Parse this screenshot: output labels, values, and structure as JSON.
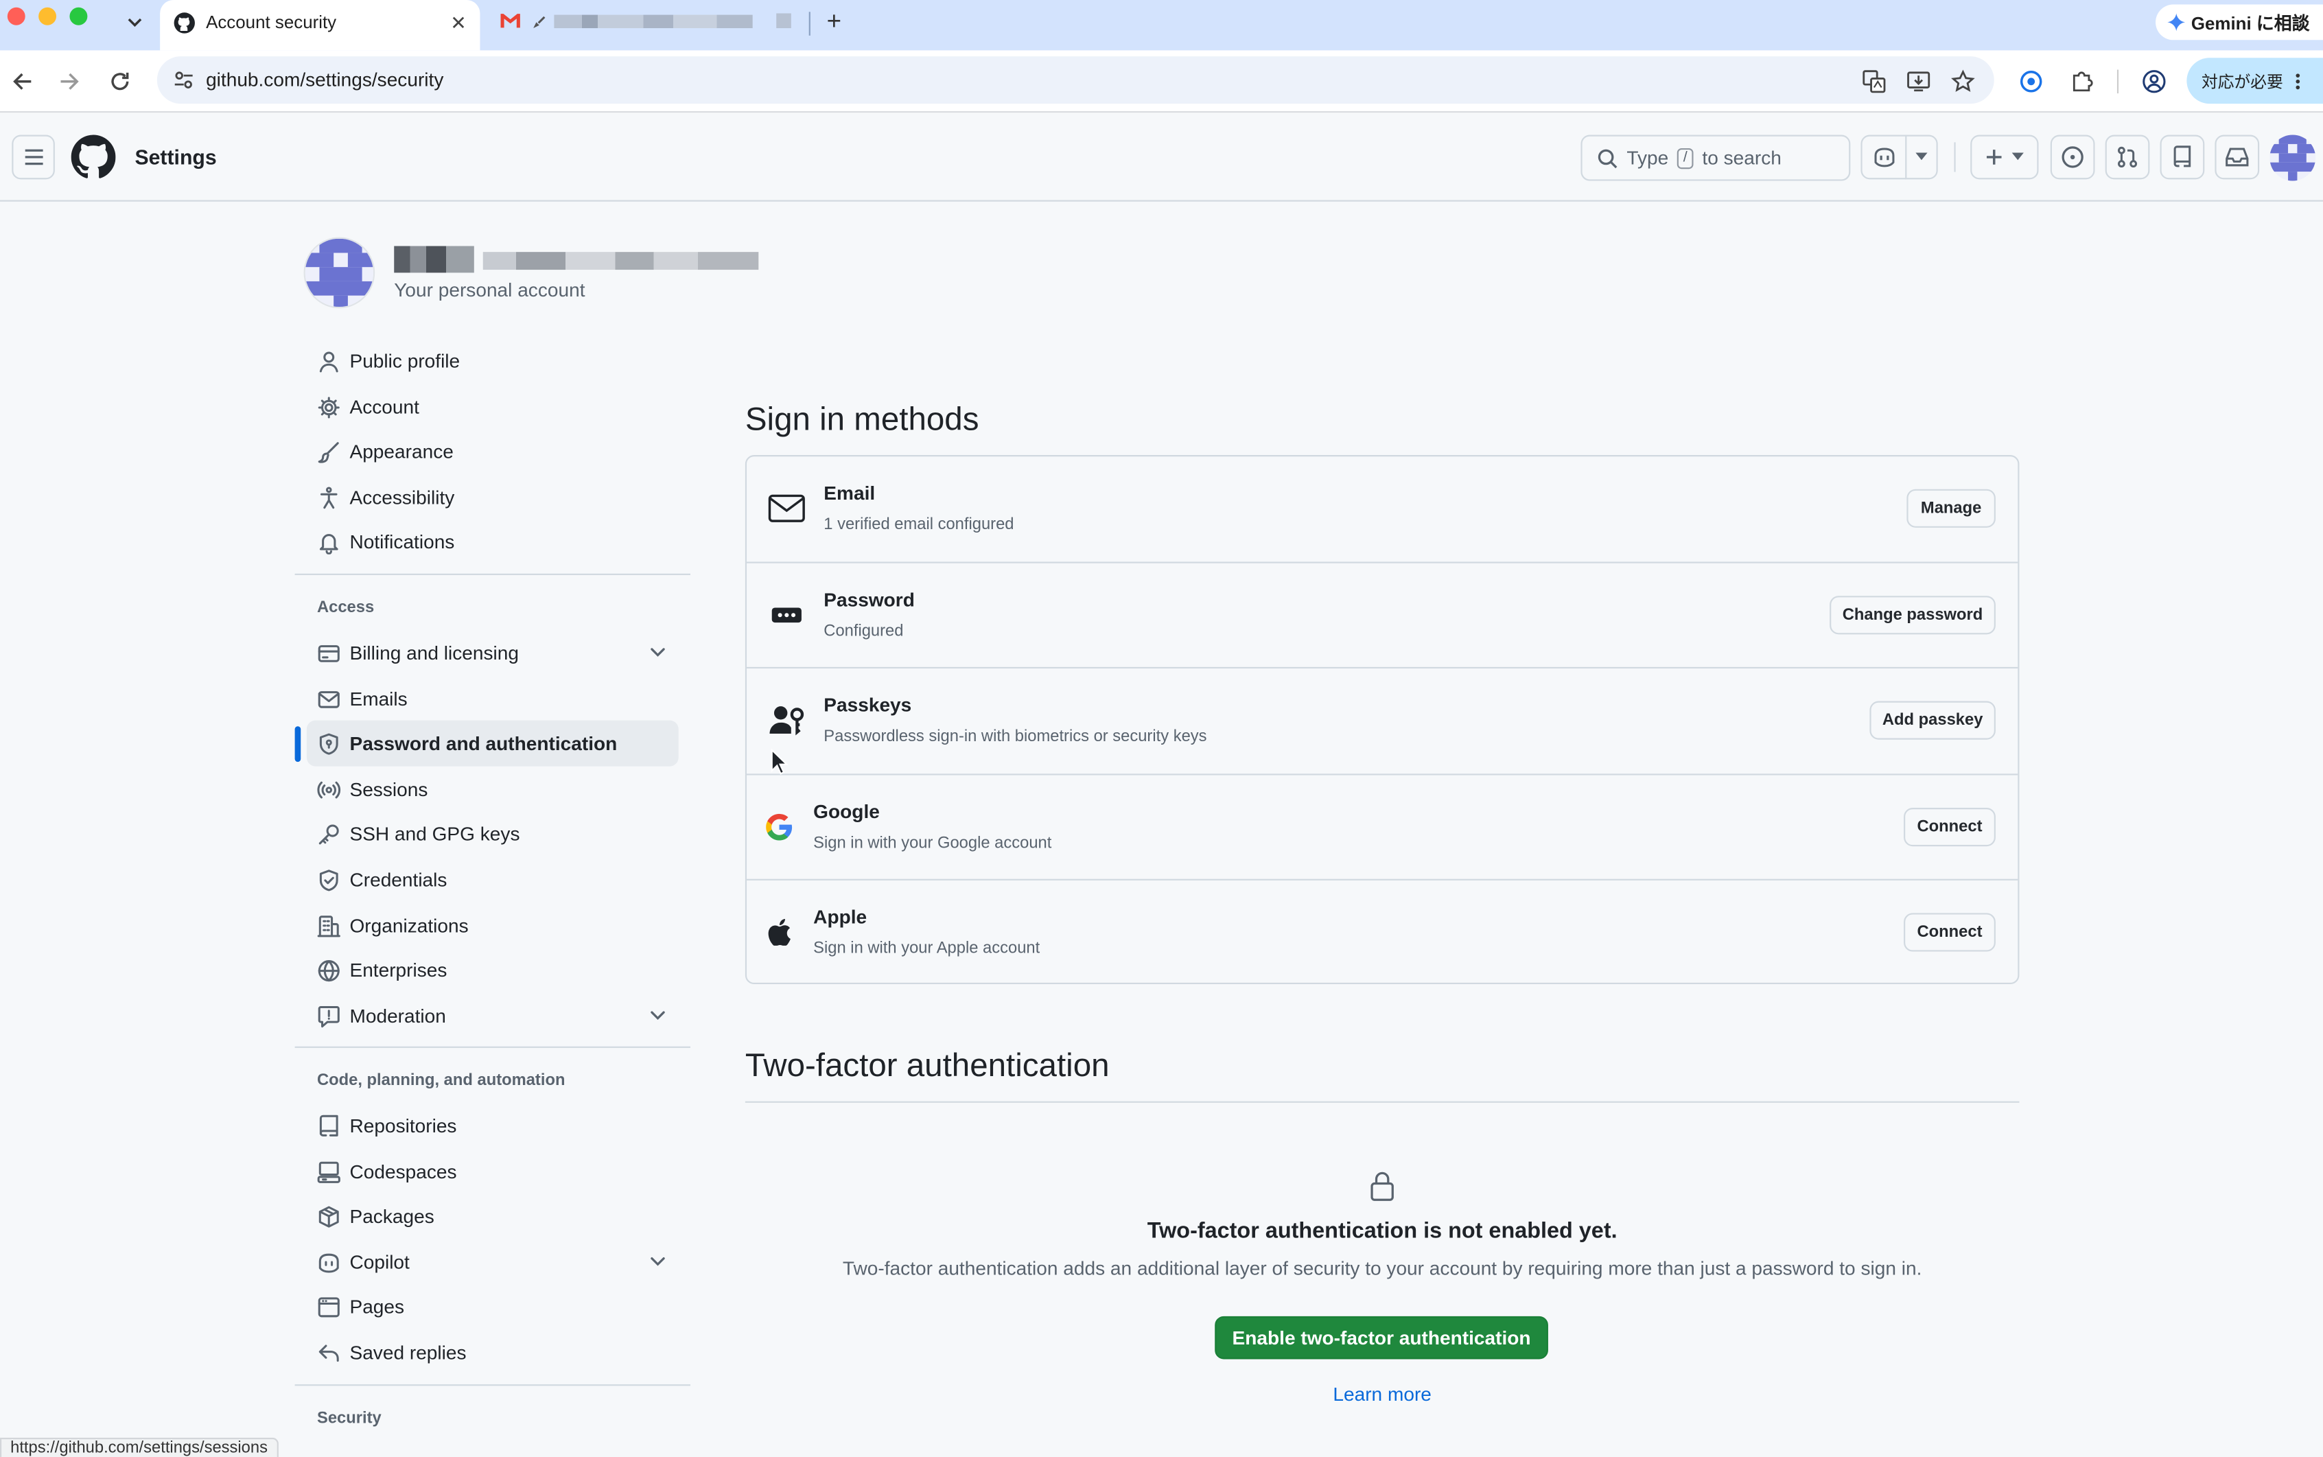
{
  "browser": {
    "active_tab_title": "Account security",
    "url": "github.com/settings/security",
    "gemini_label": "Gemini に相談",
    "update_label": "対応が必要",
    "status_url": "https://github.com/settings/sessions"
  },
  "header": {
    "title": "Settings",
    "search_prefix": "Type",
    "search_key": "/",
    "search_suffix": "to search"
  },
  "account": {
    "subtitle": "Your personal account"
  },
  "sidebar": {
    "top_items": [
      {
        "label": "Public profile",
        "icon": "person-icon"
      },
      {
        "label": "Account",
        "icon": "gear-icon"
      },
      {
        "label": "Appearance",
        "icon": "paintbrush-icon"
      },
      {
        "label": "Accessibility",
        "icon": "accessibility-icon"
      },
      {
        "label": "Notifications",
        "icon": "bell-icon"
      }
    ],
    "access_heading": "Access",
    "access_items": [
      {
        "label": "Billing and licensing",
        "icon": "credit-card-icon",
        "expandable": true
      },
      {
        "label": "Emails",
        "icon": "mail-icon"
      },
      {
        "label": "Password and authentication",
        "icon": "shield-lock-icon",
        "active": true
      },
      {
        "label": "Sessions",
        "icon": "broadcast-icon"
      },
      {
        "label": "SSH and GPG keys",
        "icon": "key-icon"
      },
      {
        "label": "Credentials",
        "icon": "shield-check-icon"
      },
      {
        "label": "Organizations",
        "icon": "organization-icon"
      },
      {
        "label": "Enterprises",
        "icon": "globe-icon"
      },
      {
        "label": "Moderation",
        "icon": "report-icon",
        "expandable": true
      }
    ],
    "code_heading": "Code, planning, and automation",
    "code_items": [
      {
        "label": "Repositories",
        "icon": "repo-icon"
      },
      {
        "label": "Codespaces",
        "icon": "codespaces-icon"
      },
      {
        "label": "Packages",
        "icon": "package-icon"
      },
      {
        "label": "Copilot",
        "icon": "copilot-icon",
        "expandable": true
      },
      {
        "label": "Pages",
        "icon": "browser-icon"
      },
      {
        "label": "Saved replies",
        "icon": "reply-icon"
      }
    ],
    "security_heading": "Security"
  },
  "signin": {
    "heading": "Sign in methods",
    "methods": [
      {
        "name": "Email",
        "desc": "1 verified email configured",
        "button": "Manage",
        "icon": "mail-icon"
      },
      {
        "name": "Password",
        "desc": "Configured",
        "button": "Change password",
        "icon": "password-icon"
      },
      {
        "name": "Passkeys",
        "desc": "Passwordless sign-in with biometrics or security keys",
        "button": "Add passkey",
        "icon": "passkey-icon"
      },
      {
        "name": "Google",
        "desc": "Sign in with your Google account",
        "button": "Connect",
        "icon": "google-icon"
      },
      {
        "name": "Apple",
        "desc": "Sign in with your Apple account",
        "button": "Connect",
        "icon": "apple-icon"
      }
    ]
  },
  "tfa": {
    "heading": "Two-factor authentication",
    "title": "Two-factor authentication is not enabled yet.",
    "desc": "Two-factor authentication adds an additional layer of security to your account by requiring more than just a password to sign in.",
    "enable_button": "Enable two-factor authentication",
    "learn_more": "Learn more"
  },
  "colors": {
    "accent": "#0969da",
    "primary_button": "#1f883d",
    "tab_strip": "#d3e3fd"
  }
}
